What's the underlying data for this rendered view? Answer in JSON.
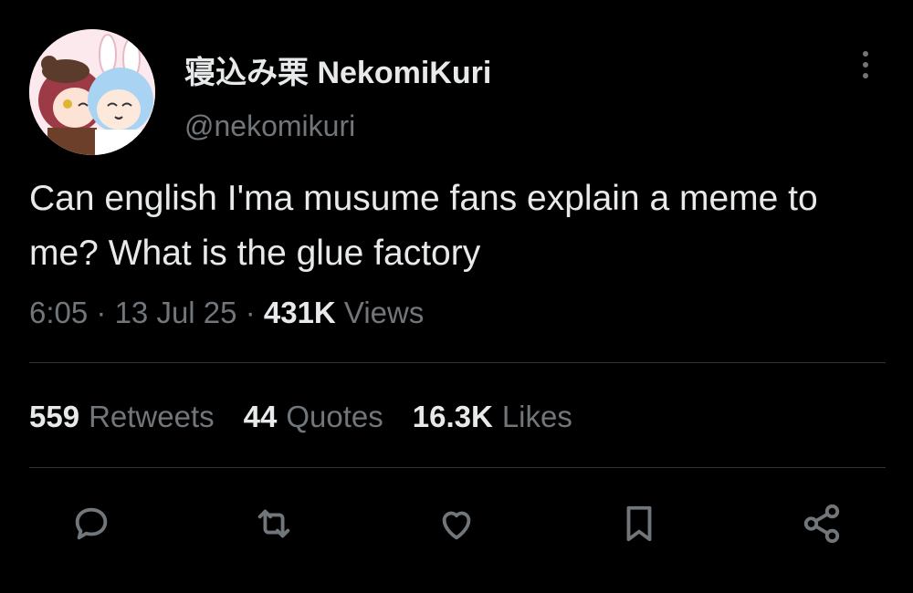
{
  "user": {
    "display_name": "寝込み栗 NekomiKuri",
    "handle": "@nekomikuri",
    "avatar_icon": "anime-avatar"
  },
  "tweet": {
    "text": "Can english I'ma musume fans explain a meme to me? What is the glue factory",
    "time": "6:05",
    "date": "13 Jul 25",
    "separator": "·",
    "views_count": "431K",
    "views_label": "Views"
  },
  "stats": {
    "retweets_count": "559",
    "retweets_label": "Retweets",
    "quotes_count": "44",
    "quotes_label": "Quotes",
    "likes_count": "16.3K",
    "likes_label": "Likes"
  },
  "icons": {
    "more": "more-vertical-icon",
    "reply": "reply-icon",
    "retweet": "retweet-icon",
    "like": "heart-icon",
    "bookmark": "bookmark-icon",
    "share": "share-icon"
  },
  "colors": {
    "background": "#000000",
    "primary_text": "#e7e9ea",
    "secondary_text": "#71767b",
    "divider": "#2f3336"
  }
}
